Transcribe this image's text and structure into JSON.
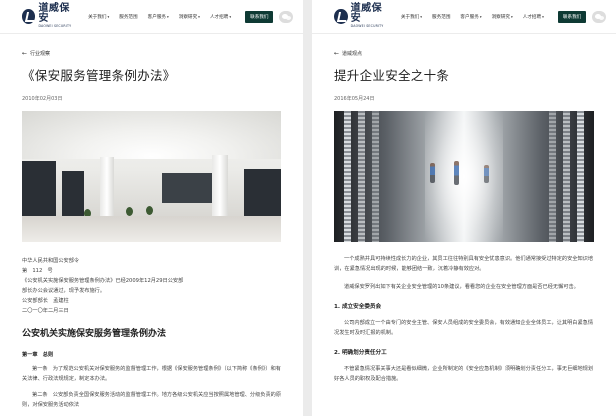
{
  "header": {
    "logo_cn": "道威保安",
    "logo_en": "DAOWEI SECURITY",
    "nav": [
      "关于我们",
      "服务范围",
      "客户服务",
      "洞察研究",
      "人才招聘"
    ],
    "contact_label": "联系我们"
  },
  "left": {
    "back_label": "行业观察",
    "title": "《保安服务管理条例办法》",
    "date": "2010年02月03日",
    "lines": [
      "中华人民共和国公安部令",
      "第　112　号",
      "《公安机关实施保安服务管理条例办法》已经2009年12月29日公安部",
      "部长办公会议通过，现予发布施行。",
      "公安部部长　孟建柱",
      "二〇一〇年二月三日"
    ],
    "heading": "公安机关实施保安服务管理条例办法",
    "chapter": "第一章　总则",
    "article1": "第一条　为了规范公安机关对保安服务的监督管理工作，根据《保安服务管理条例》（以下简称《条例》）和有关法律、行政法规规定，制定本办法。",
    "article2": "第二条　公安部负责全国保安服务活动的监督管理工作。地方各级公安机关应当按照属地管理、分级负责的原则，对保安服务活动依法"
  },
  "right": {
    "back_label": "道威观点",
    "title": "提升企业安全之十条",
    "date": "2016年05月24日",
    "intro1": "一个成熟并具可持续性成长力的企业，其员工往往特别具有安全忧患意识。他们通常接受过特定的安全知识培训，在紧急情况出现的时候，能够团结一致，沉着冷静有效应对。",
    "intro2": "道威保安罗列出如下有关企业安全管理的10条建议，看看您的企业在安全管理方面是否已经无懈可击。",
    "sec1": "1. 成立安全委员会",
    "para1": "公司内部成立一个由专门的安全主管、保安人员组成的安全委员会，有效通知企业全体员工，让其明白紧急情况发生时及时汇报的机制。",
    "sec2": "2. 明确划分责任分工",
    "para2": "不管紧急情况事关事大还是看似细微，企业所制定的《安全应急机制》须明确划分责任分工，事无巨细地规划好各人员的职权及配合措施。"
  },
  "colors": {
    "brand": "#1d2f4f",
    "contact_bg": "#0e3a34"
  }
}
